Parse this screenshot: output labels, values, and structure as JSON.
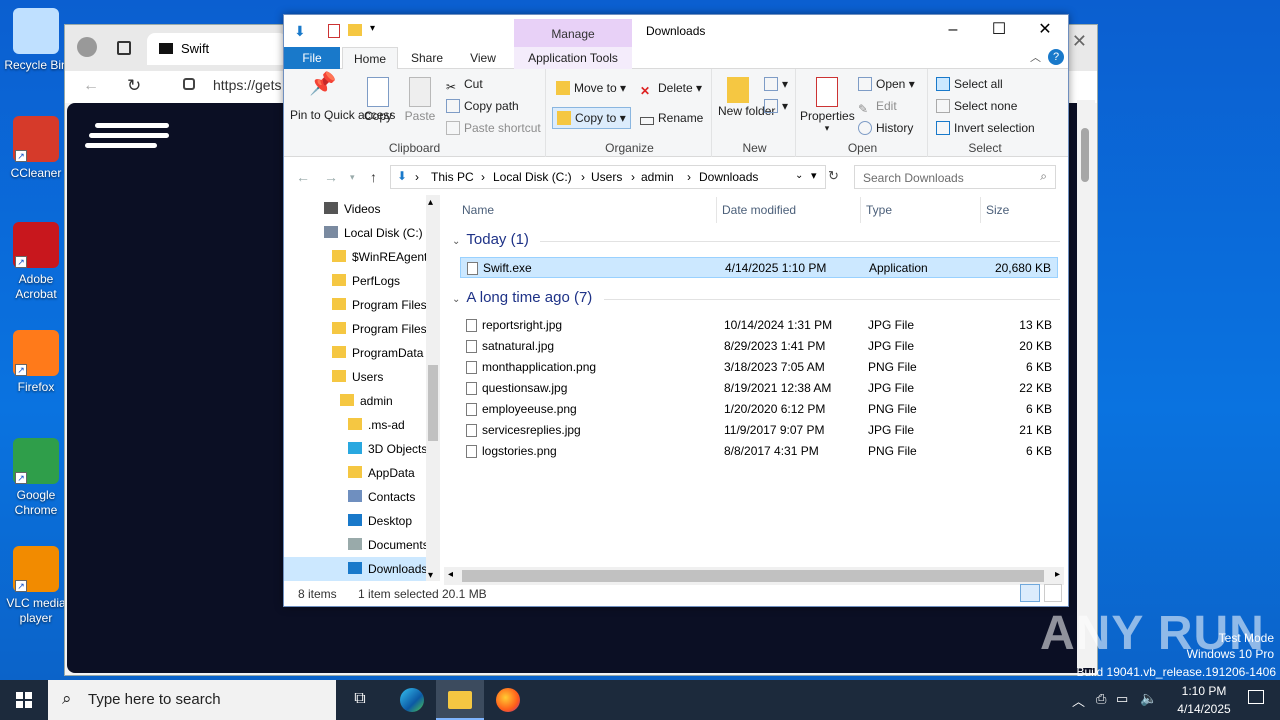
{
  "desktop": {
    "icons": [
      {
        "label": "Recycle Bin",
        "short": "Recycle Bin",
        "icon": "recycle-bin-icon",
        "color": "#bfe0ff"
      },
      {
        "label": "CCleaner",
        "icon": "ccleaner-icon",
        "color": "#d63a2a"
      },
      {
        "label": "Adobe Acrobat",
        "icon": "acrobat-icon",
        "color": "#c8171d"
      },
      {
        "label": "Firefox",
        "icon": "firefox-icon",
        "color": "#ff7a1a"
      },
      {
        "label": "Google Chrome",
        "icon": "chrome-icon",
        "color": "#2f9e4a"
      },
      {
        "label": "VLC media player",
        "icon": "vlc-icon",
        "color": "#f28b00"
      }
    ]
  },
  "browser": {
    "tab_title": "Swift",
    "url": "https://gets"
  },
  "explorer": {
    "title": "Downloads",
    "manage_tab": "Manage",
    "tabs": [
      "File",
      "Home",
      "Share",
      "View",
      "Application Tools"
    ],
    "ribbon": {
      "clipboard": {
        "label": "Clipboard",
        "pin": "Pin to Quick access",
        "copy": "Copy",
        "paste": "Paste",
        "cut": "Cut",
        "copy_path": "Copy path",
        "paste_shortcut": "Paste shortcut"
      },
      "organize": {
        "label": "Organize",
        "move_to": "Move to",
        "copy_to": "Copy to",
        "delete": "Delete",
        "rename": "Rename"
      },
      "new": {
        "label": "New",
        "new_folder": "New folder"
      },
      "open": {
        "label": "Open",
        "properties": "Properties",
        "open": "Open",
        "edit": "Edit",
        "history": "History"
      },
      "select": {
        "label": "Select",
        "select_all": "Select all",
        "select_none": "Select none",
        "invert": "Invert selection"
      }
    },
    "path": [
      "This PC",
      "Local Disk (C:)",
      "Users",
      "admin",
      "Downloads"
    ],
    "search_placeholder": "Search Downloads",
    "nav": [
      {
        "label": "Videos",
        "indent": 0,
        "icon": "videos-icon"
      },
      {
        "label": "Local Disk (C:)",
        "indent": 0,
        "icon": "drive-icon"
      },
      {
        "label": "$WinREAgent",
        "indent": 1,
        "icon": "folder-icon"
      },
      {
        "label": "PerfLogs",
        "indent": 1,
        "icon": "folder-icon"
      },
      {
        "label": "Program Files",
        "indent": 1,
        "icon": "folder-icon"
      },
      {
        "label": "Program Files",
        "indent": 1,
        "icon": "folder-icon"
      },
      {
        "label": "ProgramData",
        "indent": 1,
        "icon": "folder-icon"
      },
      {
        "label": "Users",
        "indent": 1,
        "icon": "folder-icon"
      },
      {
        "label": "admin",
        "indent": 2,
        "icon": "folder-icon"
      },
      {
        "label": ".ms-ad",
        "indent": 3,
        "icon": "folder-icon"
      },
      {
        "label": "3D Objects",
        "indent": 3,
        "icon": "3d-objects-icon"
      },
      {
        "label": "AppData",
        "indent": 3,
        "icon": "folder-icon"
      },
      {
        "label": "Contacts",
        "indent": 3,
        "icon": "contacts-icon"
      },
      {
        "label": "Desktop",
        "indent": 3,
        "icon": "desktop-icon"
      },
      {
        "label": "Documents",
        "indent": 3,
        "icon": "documents-icon"
      },
      {
        "label": "Downloads",
        "indent": 3,
        "icon": "downloads-icon",
        "selected": true
      }
    ],
    "columns": [
      "Name",
      "Date modified",
      "Type",
      "Size"
    ],
    "groups": [
      {
        "title": "Today (1)",
        "files": [
          {
            "name": "Swift.exe",
            "date": "4/14/2025 1:10 PM",
            "type": "Application",
            "size": "20,680 KB",
            "selected": true
          }
        ]
      },
      {
        "title": "A long time ago (7)",
        "files": [
          {
            "name": "reportsright.jpg",
            "date": "10/14/2024 1:31 PM",
            "type": "JPG File",
            "size": "13 KB"
          },
          {
            "name": "satnatural.jpg",
            "date": "8/29/2023 1:41 PM",
            "type": "JPG File",
            "size": "20 KB"
          },
          {
            "name": "monthapplication.png",
            "date": "3/18/2023 7:05 AM",
            "type": "PNG File",
            "size": "6 KB"
          },
          {
            "name": "questionsaw.jpg",
            "date": "8/19/2021 12:38 AM",
            "type": "JPG File",
            "size": "22 KB"
          },
          {
            "name": "employeeuse.png",
            "date": "1/20/2020 6:12 PM",
            "type": "PNG File",
            "size": "6 KB"
          },
          {
            "name": "servicesreplies.jpg",
            "date": "11/9/2017 9:07 PM",
            "type": "JPG File",
            "size": "21 KB"
          },
          {
            "name": "logstories.png",
            "date": "8/8/2017 4:31 PM",
            "type": "PNG File",
            "size": "6 KB"
          }
        ]
      }
    ],
    "status": {
      "count": "8 items",
      "selected": "1 item selected",
      "size": "20.1 MB"
    }
  },
  "watermark": {
    "brand": "ANY RUN",
    "lines": [
      "Test Mode",
      "Windows 10 Pro",
      "Build 19041.vb_release.191206-1406"
    ]
  },
  "taskbar": {
    "search_placeholder": "Type here to search",
    "time": "1:10 PM",
    "date": "4/14/2025"
  },
  "colors": {
    "accent": "#1979ca",
    "selection": "#cce8ff",
    "manage": "#e8d1f7"
  }
}
